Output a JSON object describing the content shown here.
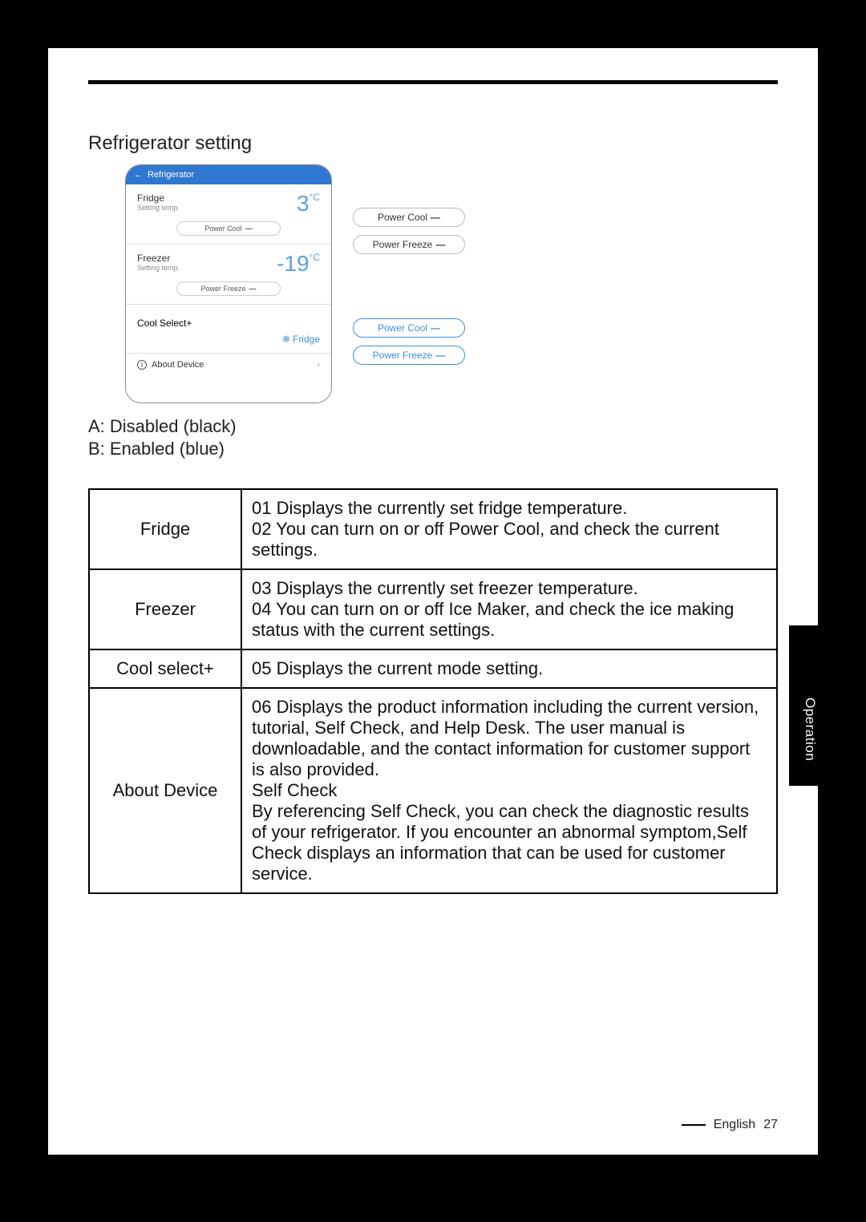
{
  "section_title": "Refrigerator setting",
  "phone": {
    "back_arrow": "←",
    "header": "Refrigerator",
    "fridge": {
      "label": "Fridge",
      "sub": "Setting temp.",
      "temp": "3",
      "unit": "°C",
      "pill": "Power Cool",
      "dash": "—"
    },
    "freezer": {
      "label": "Freezer",
      "sub": "Setting temp.",
      "temp": "-19",
      "unit": "°C",
      "pill": "Power Freeze",
      "dash": "—"
    },
    "coolselect": {
      "label": "Cool Select+",
      "icon": "❄",
      "value": "Fridge"
    },
    "about": {
      "info": "i",
      "label": "About Device",
      "chev": "›"
    }
  },
  "side": {
    "a1": "Power Cool",
    "a1d": "—",
    "a2": "Power Freeze",
    "a2d": "—",
    "b1": "Power Cool",
    "b1d": "—",
    "b2": "Power Freeze",
    "b2d": "—"
  },
  "legend": {
    "a": "A: Disabled (black)",
    "b": "B: Enabled (blue)"
  },
  "table": {
    "r1l": "Fridge",
    "r1d": "01 Displays the currently set fridge temperature.\n02 You can turn on or off Power Cool, and check the current settings.",
    "r2l": "Freezer",
    "r2d": "03 Displays the currently set freezer temperature.\n04 You can turn on or off Ice Maker, and check the ice making status with the current settings.",
    "r3l": "Cool select+",
    "r3d": "05 Displays the current mode setting.",
    "r4l": "About Device",
    "r4d": "06 Displays the product information including the current version, tutorial, Self Check, and Help Desk. The user manual is downloadable, and the contact information for customer support is also provided.\nSelf Check\nBy referencing Self Check, you can check the diagnostic results of your refrigerator. If you encounter an abnormal symptom,Self Check displays an information that can be used for customer service."
  },
  "sidetab": "Operation",
  "footer": {
    "lang": "English",
    "page": "27"
  }
}
